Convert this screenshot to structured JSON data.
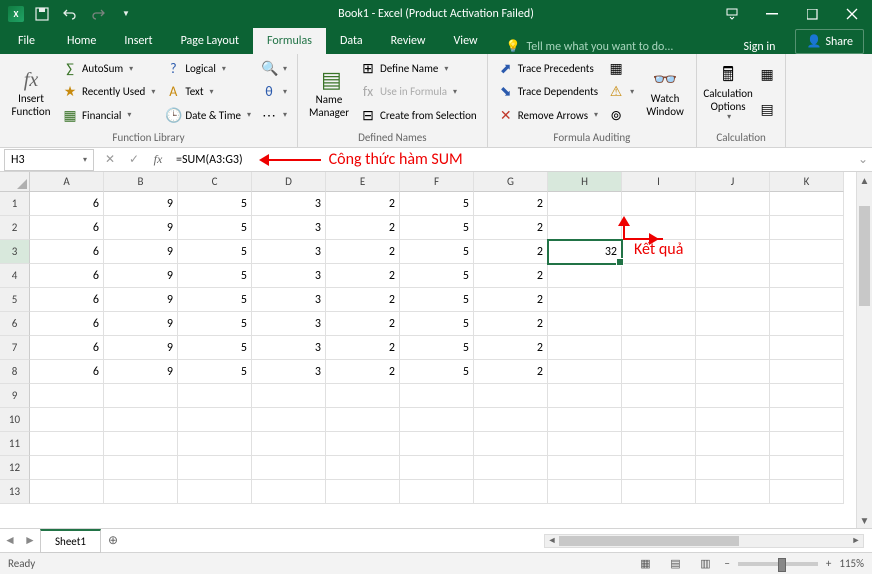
{
  "title": "Book1 - Excel (Product Activation Failed)",
  "tabs": {
    "file": "File",
    "home": "Home",
    "insert": "Insert",
    "page": "Page Layout",
    "formulas": "Formulas",
    "data": "Data",
    "review": "Review",
    "view": "View"
  },
  "tellme": "Tell me what you want to do...",
  "signin": "Sign in",
  "share": "Share",
  "ribbon": {
    "insertfn": {
      "top": "Insert",
      "bot": "Function"
    },
    "autosum": "AutoSum",
    "recent": "Recently Used",
    "financial": "Financial",
    "logical": "Logical",
    "text": "Text",
    "datetime": "Date & Time",
    "namemgr": {
      "top": "Name",
      "bot": "Manager"
    },
    "defname": "Define Name",
    "useinf": "Use in Formula",
    "createsel": "Create from Selection",
    "traceprec": "Trace Precedents",
    "tracedep": "Trace Dependents",
    "removearr": "Remove Arrows",
    "watch": {
      "top": "Watch",
      "bot": "Window"
    },
    "calcopts": {
      "top": "Calculation",
      "bot": "Options"
    },
    "g_funclib": "Function Library",
    "g_defnames": "Defined Names",
    "g_audit": "Formula Auditing",
    "g_calc": "Calculation"
  },
  "namebox": "H3",
  "formula": "=SUM(A3:G3)",
  "annot1": "Công thức hàm SUM",
  "annot2": "Kết quả",
  "cols": [
    "A",
    "B",
    "C",
    "D",
    "E",
    "F",
    "G",
    "H",
    "I",
    "J",
    "K"
  ],
  "rows": [
    "1",
    "2",
    "3",
    "4",
    "5",
    "6",
    "7",
    "8",
    "9",
    "10",
    "11",
    "12",
    "13"
  ],
  "selectedCell": {
    "row": 2,
    "col": 7
  },
  "sheet": "Sheet1",
  "status": "Ready",
  "zoom": "115%",
  "chart_data": {
    "type": "table",
    "columns": [
      "A",
      "B",
      "C",
      "D",
      "E",
      "F",
      "G",
      "H"
    ],
    "data": [
      [
        6,
        9,
        5,
        3,
        2,
        5,
        2,
        ""
      ],
      [
        6,
        9,
        5,
        3,
        2,
        5,
        2,
        ""
      ],
      [
        6,
        9,
        5,
        3,
        2,
        5,
        2,
        32
      ],
      [
        6,
        9,
        5,
        3,
        2,
        5,
        2,
        ""
      ],
      [
        6,
        9,
        5,
        3,
        2,
        5,
        2,
        ""
      ],
      [
        6,
        9,
        5,
        3,
        2,
        5,
        2,
        ""
      ],
      [
        6,
        9,
        5,
        3,
        2,
        5,
        2,
        ""
      ],
      [
        6,
        9,
        5,
        3,
        2,
        5,
        2,
        ""
      ]
    ]
  }
}
